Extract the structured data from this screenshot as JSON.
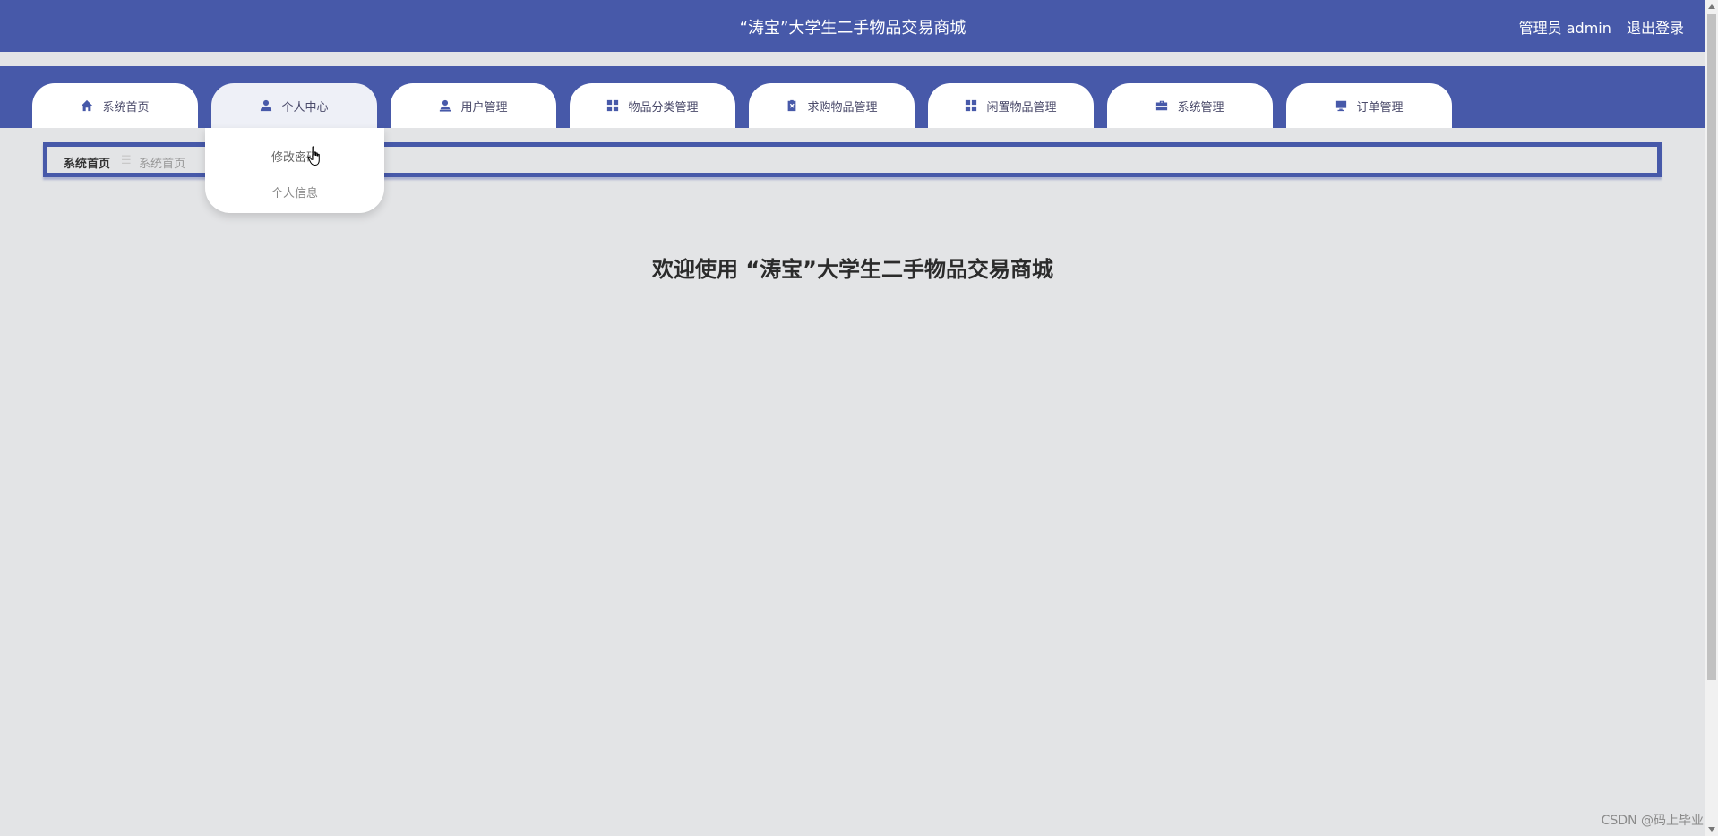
{
  "header": {
    "title": "“涛宝”大学生二手物品交易商城",
    "user_role": "管理员 admin",
    "logout_label": "退出登录"
  },
  "nav": {
    "tabs": [
      {
        "label": "系统首页",
        "icon": "home-icon"
      },
      {
        "label": "个人中心",
        "icon": "user-icon"
      },
      {
        "label": "用户管理",
        "icon": "user-manage-icon"
      },
      {
        "label": "物品分类管理",
        "icon": "grid-icon"
      },
      {
        "label": "求购物品管理",
        "icon": "clipboard-icon"
      },
      {
        "label": "闲置物品管理",
        "icon": "grid-icon"
      },
      {
        "label": "系统管理",
        "icon": "briefcase-icon"
      },
      {
        "label": "订单管理",
        "icon": "monitor-icon"
      }
    ],
    "active_tab": "个人中心"
  },
  "dropdown": {
    "items": [
      "修改密码",
      "个人信息"
    ]
  },
  "breadcrumb": {
    "root": "系统首页",
    "separator": "☰",
    "current": "系统首页"
  },
  "main": {
    "welcome": "欢迎使用 “涛宝”大学生二手物品交易商城"
  },
  "watermark": "CSDN @码上毕业",
  "colors": {
    "primary": "#4759a9",
    "background": "#e3e4e6"
  }
}
